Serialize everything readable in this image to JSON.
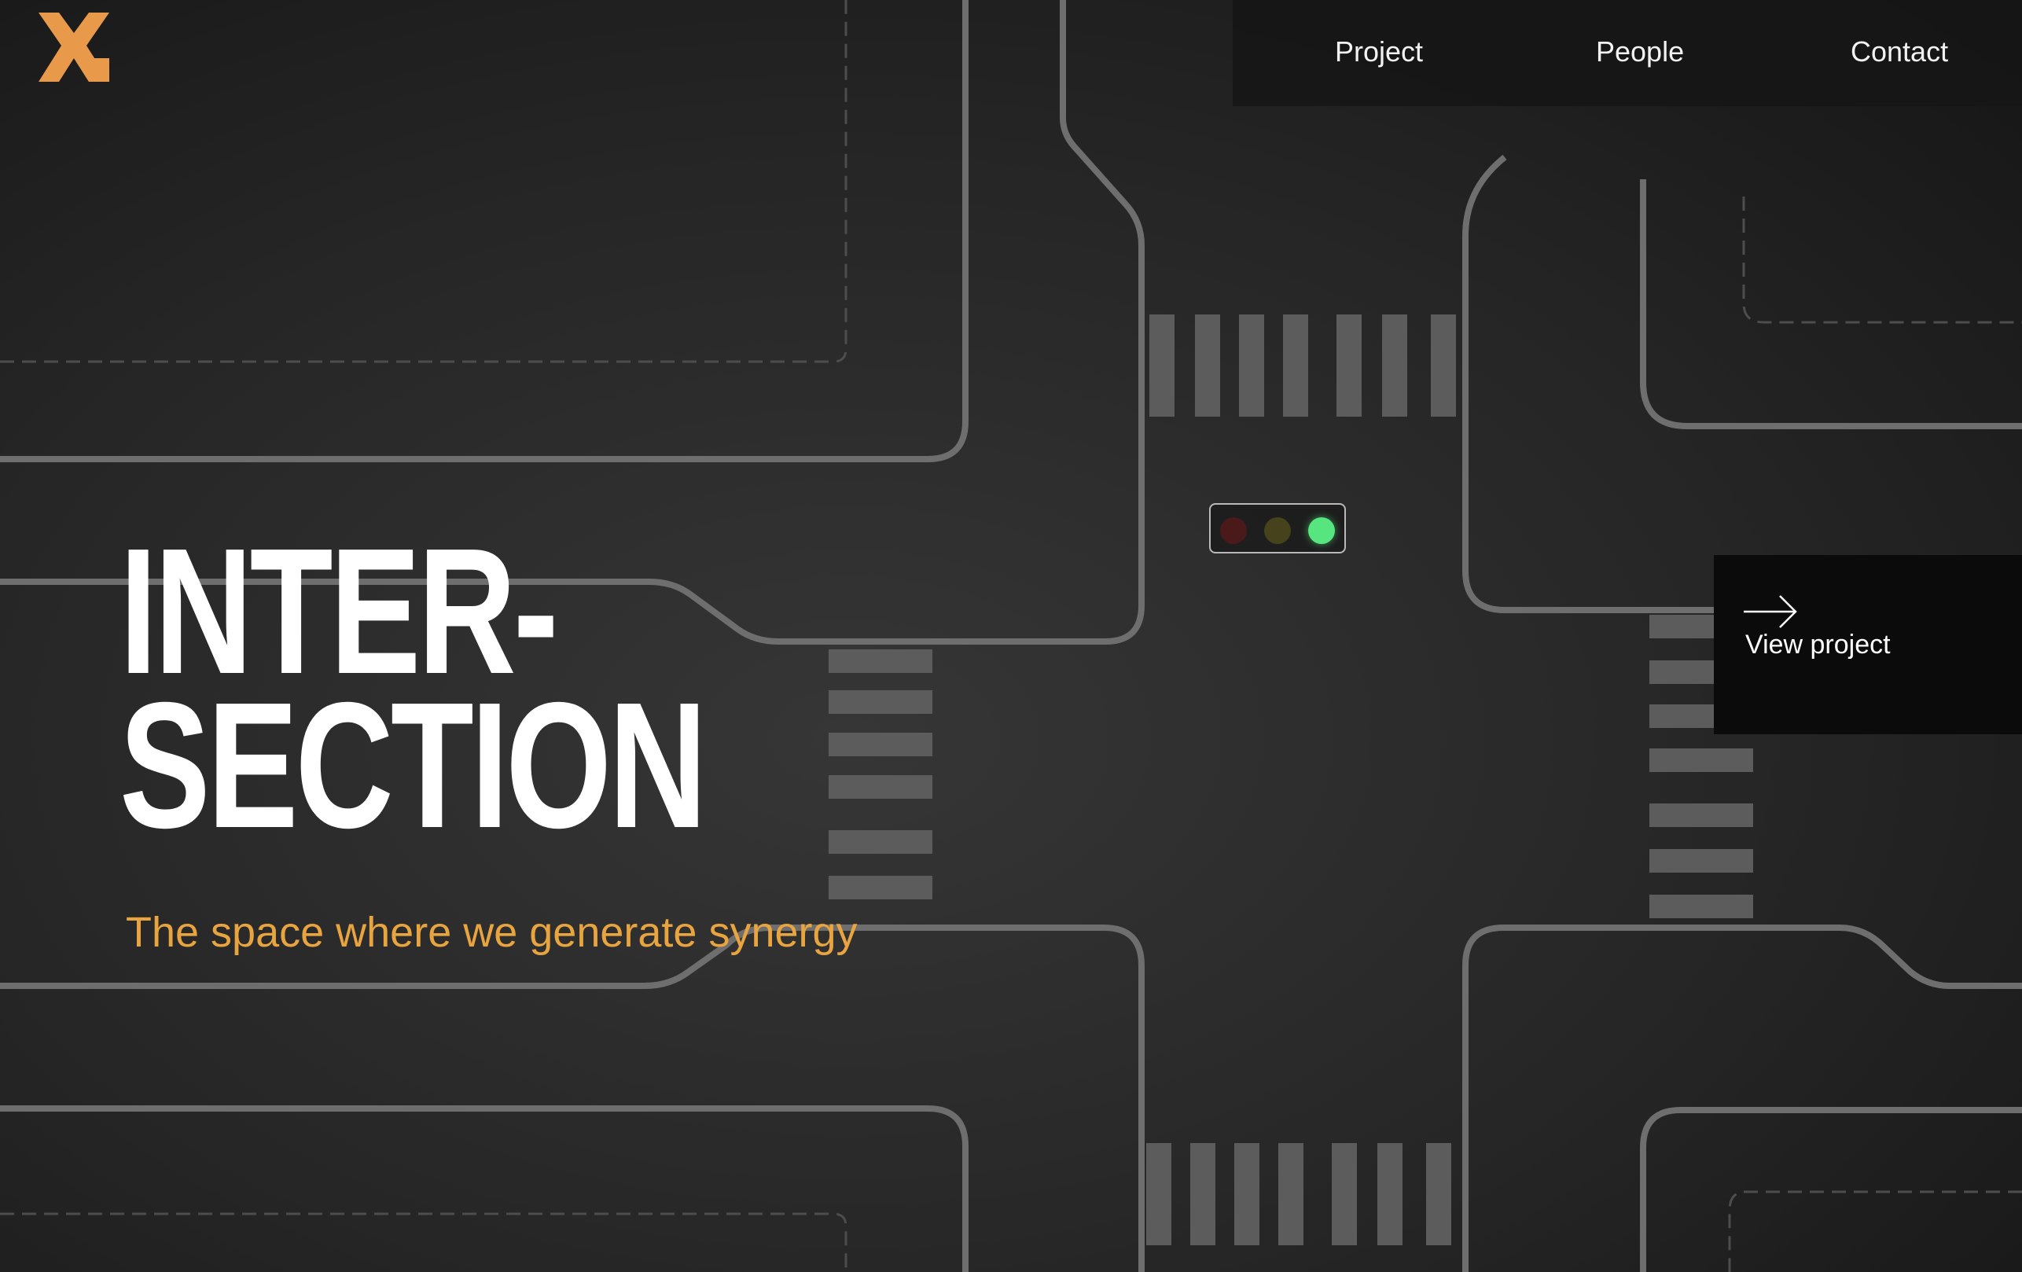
{
  "brand": {
    "logo_icon": "x-logo-icon",
    "accent_color": "#e89a4a"
  },
  "nav": {
    "items": [
      {
        "label": "Project"
      },
      {
        "label": "People"
      },
      {
        "label": "Contact"
      }
    ]
  },
  "hero": {
    "title_line1": "INTER-",
    "title_line2": "SECTION",
    "subtitle": "The space where we generate synergy",
    "subtitle_color": "#e8a43f"
  },
  "traffic_light": {
    "lamps": [
      "red",
      "yellow",
      "green"
    ],
    "active_lamp": "green",
    "active_color": "#57e57f"
  },
  "cta": {
    "label": "View project",
    "icon": "arrow-right-icon"
  }
}
